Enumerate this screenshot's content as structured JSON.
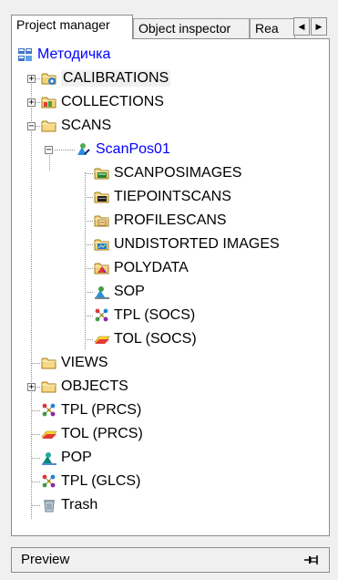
{
  "tabs": [
    {
      "label": "Project manager"
    },
    {
      "label": "Object inspector"
    },
    {
      "label": "Rea"
    }
  ],
  "tree": [
    {
      "label": "Методичка",
      "icon": "project-icon",
      "blue": true
    },
    {
      "label": "CALIBRATIONS",
      "icon": "calibrations-folder-icon",
      "expand": "+"
    },
    {
      "label": "COLLECTIONS",
      "icon": "collections-folder-icon",
      "expand": "+"
    },
    {
      "label": "SCANS",
      "icon": "folder-icon",
      "expand": "-"
    },
    {
      "label": "ScanPos01",
      "icon": "scanpos-icon",
      "expand": "-",
      "blue": true
    },
    {
      "label": "SCANPOSIMAGES",
      "icon": "scanposimages-folder-icon"
    },
    {
      "label": "TIEPOINTSCANS",
      "icon": "tiepointscans-folder-icon"
    },
    {
      "label": "PROFILESCANS",
      "icon": "profilescans-folder-icon"
    },
    {
      "label": "UNDISTORTED IMAGES",
      "icon": "undistorted-images-folder-icon"
    },
    {
      "label": "POLYDATA",
      "icon": "polydata-folder-icon"
    },
    {
      "label": "SOP",
      "icon": "sop-icon"
    },
    {
      "label": "TPL (SOCS)",
      "icon": "tiepoint-list-icon"
    },
    {
      "label": "TOL (SOCS)",
      "icon": "tiepoint-object-icon"
    },
    {
      "label": "VIEWS",
      "icon": "folder-icon"
    },
    {
      "label": "OBJECTS",
      "icon": "folder-icon",
      "expand": "+"
    },
    {
      "label": "TPL (PRCS)",
      "icon": "tiepoint-list-icon"
    },
    {
      "label": "TOL (PRCS)",
      "icon": "tiepoint-object-icon"
    },
    {
      "label": "POP",
      "icon": "pop-icon"
    },
    {
      "label": "TPL (GLCS)",
      "icon": "tiepoint-list-icon"
    },
    {
      "label": "Trash",
      "icon": "trash-icon"
    }
  ],
  "preview": {
    "label": "Preview"
  }
}
